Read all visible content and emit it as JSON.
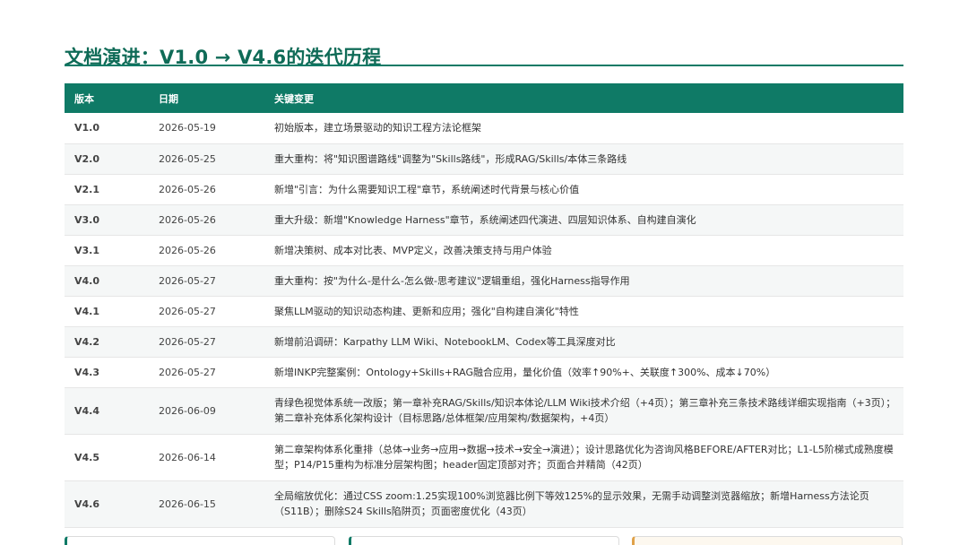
{
  "page": {
    "title": "文档演进：V1.0 → V4.6的迭代历程"
  },
  "table": {
    "headers": {
      "version": "版本",
      "date": "日期",
      "change": "关键变更"
    },
    "rows": [
      {
        "version": "V1.0",
        "date": "2026-05-19",
        "change": "初始版本，建立场景驱动的知识工程方法论框架"
      },
      {
        "version": "V2.0",
        "date": "2026-05-25",
        "change": "重大重构：将\"知识图谱路线\"调整为\"Skills路线\"，形成RAG/Skills/本体三条路线"
      },
      {
        "version": "V2.1",
        "date": "2026-05-26",
        "change": "新增\"引言：为什么需要知识工程\"章节，系统阐述时代背景与核心价值"
      },
      {
        "version": "V3.0",
        "date": "2026-05-26",
        "change": "重大升级：新增\"Knowledge Harness\"章节，系统阐述四代演进、四层知识体系、自构建自演化"
      },
      {
        "version": "V3.1",
        "date": "2026-05-26",
        "change": "新增决策树、成本对比表、MVP定义，改善决策支持与用户体验"
      },
      {
        "version": "V4.0",
        "date": "2026-05-27",
        "change": "重大重构：按\"为什么-是什么-怎么做-思考建议\"逻辑重组，强化Harness指导作用"
      },
      {
        "version": "V4.1",
        "date": "2026-05-27",
        "change": "聚焦LLM驱动的知识动态构建、更新和应用；强化\"自构建自演化\"特性"
      },
      {
        "version": "V4.2",
        "date": "2026-05-27",
        "change": "新增前沿调研：Karpathy LLM Wiki、NotebookLM、Codex等工具深度对比"
      },
      {
        "version": "V4.3",
        "date": "2026-05-27",
        "change": "新增INKP完整案例：Ontology+Skills+RAG融合应用，量化价值（效率↑90%+、关联度↑300%、成本↓70%）"
      },
      {
        "version": "V4.4",
        "date": "2026-06-09",
        "change": "青绿色视觉体系统一改版；第一章补充RAG/Skills/知识本体论/LLM Wiki技术介绍（+4页）；第三章补充三条技术路线详细实现指南（+3页）；第二章补充体系化架构设计（目标思路/总体框架/应用架构/数据架构，+4页）"
      },
      {
        "version": "V4.5",
        "date": "2026-06-14",
        "change": "第二章架构体系化重排（总体→业务→应用→数据→技术→安全→演进）；设计思路优化为咨询风格BEFORE/AFTER对比；L1-L5阶梯式成熟度模型；P14/P15重构为标准分层架构图；header固定顶部对齐；页面合并精简（42页）"
      },
      {
        "version": "V4.6",
        "date": "2026-06-15",
        "change": "全局缩放优化：通过CSS zoom:1.25实现100%浏览器比例下等效125%的显示效果，无需手动调整浏览器缩放；新增Harness方法论页（S11B）；删除S24 Skills陷阱页；页面密度优化（43页）"
      }
    ]
  },
  "colors": {
    "accent": "#0f7a66",
    "title": "#0f6b57",
    "card_warm_accent": "#e0a24a"
  }
}
